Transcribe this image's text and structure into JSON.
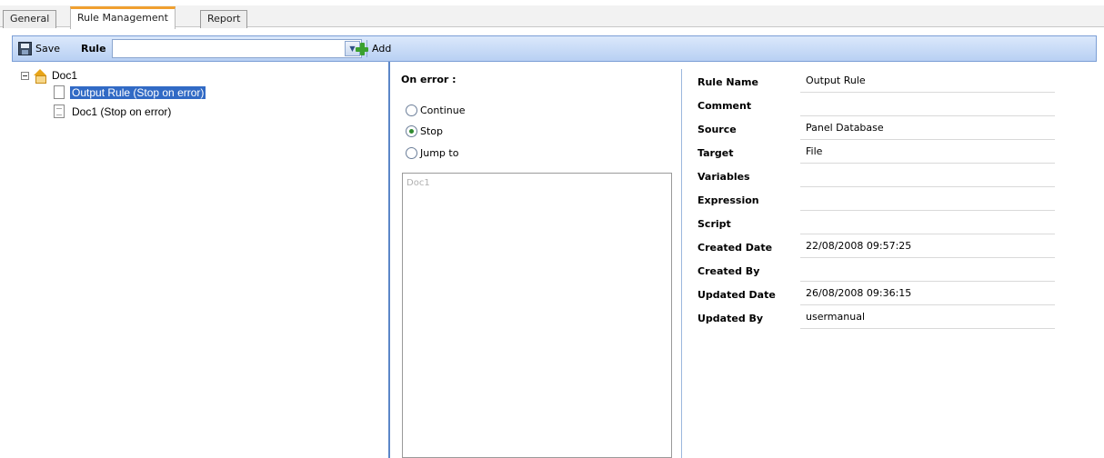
{
  "tabs": [
    {
      "label": "General"
    },
    {
      "label": "Rule Management"
    },
    {
      "label": "Report"
    }
  ],
  "toolbar": {
    "save_label": "Save",
    "rule_label": "Rule",
    "rule_combo_value": "",
    "add_label": "Add"
  },
  "tree": {
    "root_label": "Doc1",
    "items": [
      {
        "label": "Output Rule (Stop on error)"
      },
      {
        "label": "Doc1 (Stop on error)"
      }
    ]
  },
  "on_error": {
    "title": "On error :",
    "options": [
      {
        "label": "Continue"
      },
      {
        "label": "Stop"
      },
      {
        "label": "Jump to"
      }
    ],
    "selected": "Stop",
    "target_list": [
      "Doc1"
    ]
  },
  "properties": [
    {
      "label": "Rule Name",
      "value": "Output Rule"
    },
    {
      "label": "Comment",
      "value": ""
    },
    {
      "label": "Source",
      "value": "Panel Database"
    },
    {
      "label": "Target",
      "value": "File"
    },
    {
      "label": "Variables",
      "value": ""
    },
    {
      "label": "Expression",
      "value": ""
    },
    {
      "label": "Script",
      "value": ""
    },
    {
      "label": "Created Date",
      "value": "22/08/2008 09:57:25"
    },
    {
      "label": "Created By",
      "value": ""
    },
    {
      "label": "Updated Date",
      "value": "26/08/2008 09:36:15"
    },
    {
      "label": "Updated By",
      "value": "usermanual"
    }
  ],
  "colors": {
    "accent_tab": "#f0a030",
    "toolbar": "#b8d0f3",
    "selection": "#316ac5"
  }
}
